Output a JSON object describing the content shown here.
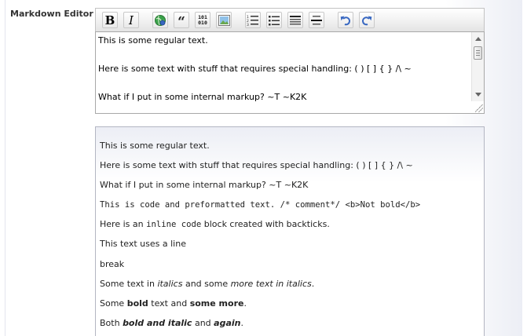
{
  "field": {
    "label": "Markdown Editor"
  },
  "toolbar": {
    "buttons": [
      {
        "name": "bold",
        "glyph": "B"
      },
      {
        "name": "italic",
        "glyph": "I"
      },
      {
        "name": "link",
        "glyph": ""
      },
      {
        "name": "quote",
        "glyph": "“"
      },
      {
        "name": "code",
        "glyph_top": "101",
        "glyph_bottom": "010"
      },
      {
        "name": "image",
        "glyph": ""
      },
      {
        "name": "numbered-list",
        "glyph": ""
      },
      {
        "name": "bulleted-list",
        "glyph": ""
      },
      {
        "name": "heading",
        "glyph": ""
      },
      {
        "name": "horizontal-rule",
        "glyph": ""
      },
      {
        "name": "undo",
        "glyph": ""
      },
      {
        "name": "redo",
        "glyph": ""
      }
    ],
    "colors": {
      "icon_blue": "#3767c1",
      "icon_green": "#3aa14a"
    }
  },
  "editor": {
    "lines": [
      "This is some regular text.",
      "Here is some text with stuff that requires special handling: ( ) [ ] { } /\\ ~",
      "What if I put in some internal markup?  ~T ~K2K"
    ]
  },
  "preview": {
    "p1": "This is some regular text.",
    "p2": "Here is some text with stuff that requires special handling: ( ) [ ] { } /\\ ~",
    "p3": "What if I put in some internal markup? ~T ~K2K",
    "p4": "This is code and preformatted text. /* comment*/ <b>Not bold</b>",
    "p5": {
      "before": "Here is an ",
      "code": "inline code",
      "after": " block created with backticks."
    },
    "p6": "This text uses a line",
    "p7": "break",
    "p8": {
      "before": "Some text in ",
      "italic1": "italics",
      "middle": " and some ",
      "italic2": "more text in italics",
      "after": "."
    },
    "p9": {
      "before": "Some ",
      "bold1": "bold",
      "middle": " text and ",
      "bold2": "some more",
      "after": "."
    },
    "p10": {
      "before": "Both ",
      "bolditalic1": "bold and italic",
      "middle": " and ",
      "bolditalic2": "again",
      "after": "."
    }
  }
}
